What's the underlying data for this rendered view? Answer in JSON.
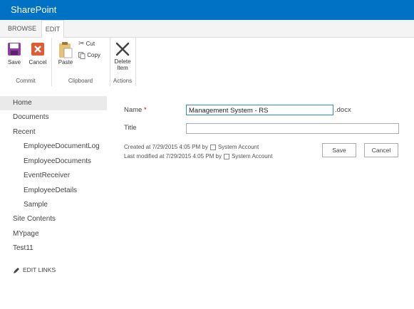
{
  "app": {
    "brand": "SharePoint"
  },
  "tabs": [
    {
      "label": "BROWSE"
    },
    {
      "label": "EDIT"
    }
  ],
  "ribbon": {
    "commit": {
      "label": "Commit",
      "save": "Save",
      "cancel": "Cancel"
    },
    "clipboard": {
      "label": "Clipboard",
      "paste": "Paste",
      "cut": "Cut",
      "copy": "Copy"
    },
    "actions": {
      "label": "Actions",
      "delete_line1": "Delete",
      "delete_line2": "Item"
    }
  },
  "nav": {
    "items": [
      {
        "label": "Home"
      },
      {
        "label": "Documents"
      },
      {
        "label": "Recent"
      },
      {
        "label": "EmployeeDocumentLog"
      },
      {
        "label": "EmployeeDocuments"
      },
      {
        "label": "EventReceiver"
      },
      {
        "label": "EmployeeDetails"
      },
      {
        "label": "Sample"
      },
      {
        "label": "Site Contents"
      },
      {
        "label": "MYpage"
      },
      {
        "label": "Test11"
      }
    ],
    "edit_links": "EDIT LINKS"
  },
  "form": {
    "name_label": "Name",
    "required_mark": "*",
    "name_value": "Management System - RS",
    "name_suffix": ".docx",
    "title_label": "Title",
    "title_value": "",
    "created": "Created at 7/29/2015 4:05 PM  by",
    "modified": "Last modified at 7/29/2015 4:05 PM  by",
    "created_by": "System Account",
    "modified_by": "System Account",
    "save": "Save",
    "cancel": "Cancel"
  },
  "colors": {
    "suite_bar": "#0072c6",
    "save_icon": "#8e3e9e",
    "cancel_icon": "#e05a35"
  }
}
